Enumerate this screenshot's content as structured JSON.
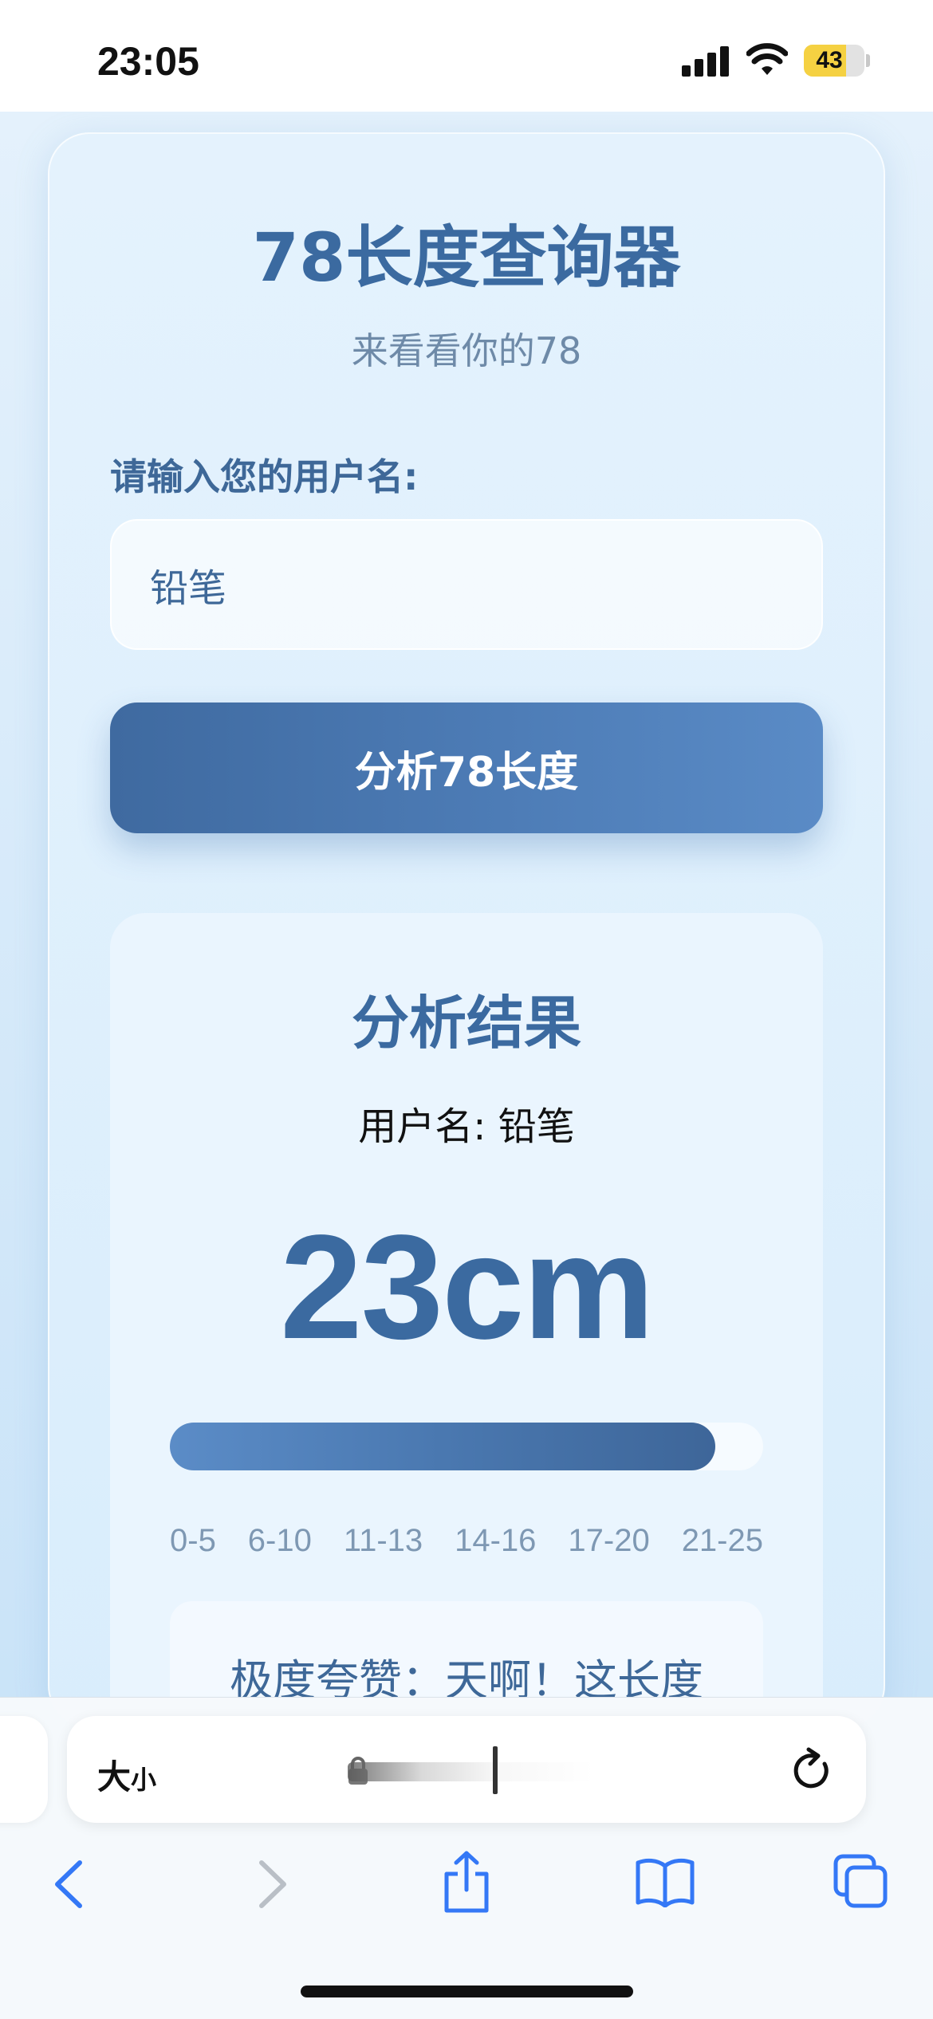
{
  "status_bar": {
    "time": "23:05",
    "battery": "43"
  },
  "app": {
    "title": "78长度查询器",
    "subtitle": "来看看你的78",
    "input_label": "请输入您的用户名:",
    "input_value": "铅笔",
    "analyze_button": "分析78长度"
  },
  "result": {
    "title": "分析结果",
    "username_line": "用户名: 铅笔",
    "value": "23cm",
    "progress_fraction": 0.92,
    "ranges": [
      "0-5",
      "6-10",
      "11-13",
      "14-16",
      "17-20",
      "21-25"
    ],
    "comment": "极度夸赞：天啊！这长度"
  },
  "browser": {
    "text_size_big": "大",
    "text_size_small": "小"
  },
  "colors": {
    "accent": "#3b6aa0",
    "button_gradient_start": "#3f6aa0",
    "button_gradient_end": "#5a8bc6",
    "safari_blue": "#3478f6",
    "battery_yellow": "#f5d142"
  },
  "icons": {
    "signal": "cellular-signal-icon",
    "wifi": "wifi-icon",
    "battery": "battery-icon",
    "lock": "lock-icon",
    "reload": "reload-icon",
    "back": "chevron-left-icon",
    "forward": "chevron-right-icon",
    "share": "share-icon",
    "bookmarks": "book-icon",
    "tabs": "tabs-icon"
  }
}
